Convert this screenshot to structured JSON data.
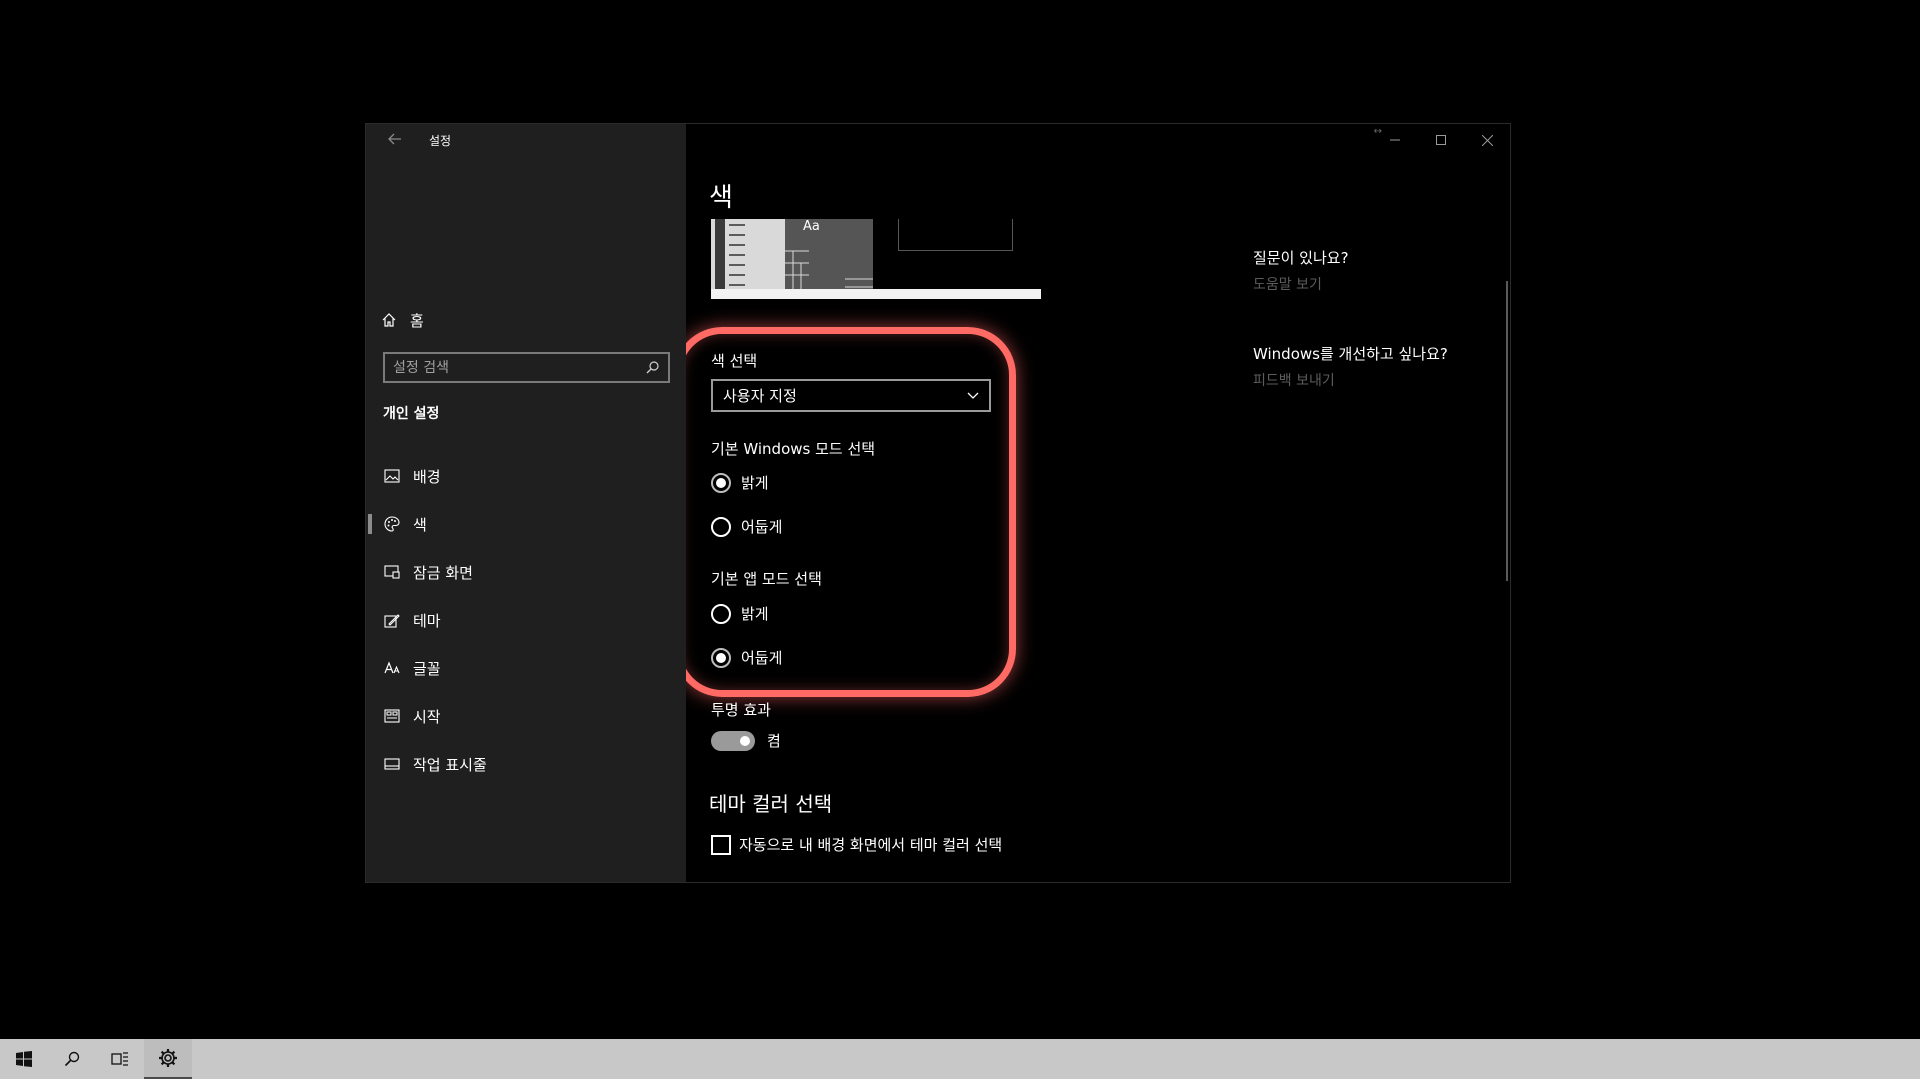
{
  "window": {
    "title": "설정",
    "controls": {
      "resize": "↔"
    }
  },
  "sidebar": {
    "home_label": "홈",
    "search_placeholder": "설정 검색",
    "section": "개인 설정",
    "items": [
      {
        "label": "배경",
        "icon": "picture-icon"
      },
      {
        "label": "색",
        "icon": "palette-icon",
        "active": true
      },
      {
        "label": "잠금 화면",
        "icon": "lock-screen-icon"
      },
      {
        "label": "테마",
        "icon": "theme-icon"
      },
      {
        "label": "글꼴",
        "icon": "font-icon"
      },
      {
        "label": "시작",
        "icon": "start-icon"
      },
      {
        "label": "작업 표시줄",
        "icon": "taskbar-icon"
      }
    ]
  },
  "main": {
    "title": "색",
    "preview_text": "Aa",
    "color_select": {
      "label": "색 선택",
      "value": "사용자 지정"
    },
    "windows_mode": {
      "label": "기본 Windows 모드 선택",
      "options": [
        "밝게",
        "어둡게"
      ],
      "selected": "밝게"
    },
    "app_mode": {
      "label": "기본 앱 모드 선택",
      "options": [
        "밝게",
        "어둡게"
      ],
      "selected": "어둡게"
    },
    "transparency": {
      "label": "투명 효과",
      "state": "켬",
      "on": true
    },
    "accent_heading": "테마 컬러 선택",
    "auto_accent": {
      "label": "자동으로 내 배경 화면에서 테마 컬러 선택",
      "checked": false
    }
  },
  "help": {
    "question": "질문이 있나요?",
    "question_link": "도움말 보기",
    "improve": "Windows를 개선하고 싶나요?",
    "improve_link": "피드백 보내기"
  },
  "colors": {
    "highlight": "#ff6a64",
    "sidebar_bg": "#1f1f1f",
    "content_bg": "#000000",
    "taskbar_bg": "#c8c8c8"
  }
}
